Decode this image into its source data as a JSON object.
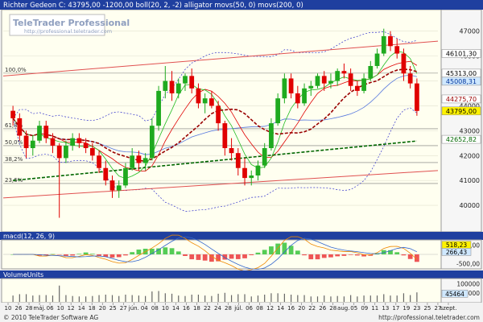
{
  "title": "Richter Gedeon C: 43795,00 -1200,00 boll(20, 2, -2) alligator movs(50, 0) movs(200, 0)",
  "watermark": {
    "brand": "TeleTrader Professional",
    "url": "http://professional.teletrader.com"
  },
  "footer": {
    "copyright": "© 2010 TeleTrader Software AG",
    "url": "http://professional.teletrader.com"
  },
  "colors": {
    "background": "#fffff0",
    "panel_header": "#1f3f9f",
    "candle_up": "#1faa1f",
    "candle_down": "#e00000",
    "boll": "#3333cc",
    "movs50": "#990000",
    "movs200": "#006600",
    "channel": "#e05050",
    "volume": "#666666"
  },
  "chart_data": [
    {
      "type": "candlestick",
      "ylim": [
        39000,
        47800
      ],
      "y_ticks": [
        "47000",
        "46000",
        "45000",
        "44000",
        "43000",
        "42000",
        "41000",
        "40000"
      ],
      "fib_levels": [
        {
          "label": "100,0%",
          "value": 45313
        },
        {
          "label": "61,8%",
          "value": 43080
        },
        {
          "label": "50,0%",
          "value": 42400
        },
        {
          "label": "38,2%",
          "value": 41720
        },
        {
          "label": "23,6%",
          "value": 40880
        }
      ],
      "price_tags": [
        {
          "text": "46101,30",
          "value": 46101,
          "bg": "#ffffff",
          "fg": "#000000"
        },
        {
          "text": "45313,00",
          "value": 45313,
          "bg": "#ffffff",
          "fg": "#000000"
        },
        {
          "text": "45008,31",
          "value": 45008,
          "bg": "#cfe8ff",
          "fg": "#003399"
        },
        {
          "text": "44275,70",
          "value": 44276,
          "bg": "#ffffff",
          "fg": "#990000"
        },
        {
          "text": "43795,00",
          "value": 43795,
          "bg": "#fff200",
          "fg": "#000000"
        },
        {
          "text": "42652,82",
          "value": 42653,
          "bg": "#ffffff",
          "fg": "#006600"
        }
      ],
      "candles_ohlc": [
        [
          43800,
          44000,
          43200,
          43500
        ],
        [
          43500,
          43700,
          42600,
          42800
        ],
        [
          42800,
          43000,
          41900,
          42300
        ],
        [
          42300,
          42800,
          42000,
          42600
        ],
        [
          42600,
          43400,
          42500,
          43200
        ],
        [
          43200,
          43400,
          42500,
          42700
        ],
        [
          42700,
          42900,
          42100,
          42400
        ],
        [
          42400,
          42500,
          39500,
          41900
        ],
        [
          41900,
          42600,
          41700,
          42400
        ],
        [
          42400,
          42900,
          42200,
          42700
        ],
        [
          42700,
          42900,
          42300,
          42500
        ],
        [
          42500,
          42700,
          42100,
          42300
        ],
        [
          42300,
          42500,
          41800,
          42000
        ],
        [
          42000,
          42200,
          41300,
          41500
        ],
        [
          41500,
          41800,
          40800,
          41000
        ],
        [
          41000,
          41200,
          40300,
          40600
        ],
        [
          40600,
          41000,
          40300,
          40800
        ],
        [
          40800,
          41700,
          40700,
          41500
        ],
        [
          41500,
          42300,
          41400,
          42000
        ],
        [
          42000,
          42200,
          41400,
          41700
        ],
        [
          41700,
          42100,
          41400,
          41900
        ],
        [
          41900,
          43500,
          41800,
          43200
        ],
        [
          43200,
          44800,
          43000,
          44600
        ],
        [
          44600,
          45600,
          44300,
          45000
        ],
        [
          45000,
          45400,
          44200,
          44500
        ],
        [
          44500,
          45100,
          44300,
          44900
        ],
        [
          44900,
          45300,
          44600,
          45200
        ],
        [
          45200,
          45500,
          44500,
          44700
        ],
        [
          44700,
          44900,
          43900,
          44100
        ],
        [
          44100,
          44500,
          43700,
          44300
        ],
        [
          44300,
          44600,
          43900,
          44000
        ],
        [
          44000,
          44200,
          43000,
          43300
        ],
        [
          43300,
          43400,
          42000,
          42300
        ],
        [
          42300,
          42700,
          41800,
          42100
        ],
        [
          42100,
          42300,
          41200,
          41500
        ],
        [
          41500,
          41900,
          40800,
          41100
        ],
        [
          41100,
          41400,
          40800,
          41200
        ],
        [
          41200,
          41800,
          41000,
          41600
        ],
        [
          41600,
          42500,
          41500,
          42300
        ],
        [
          42300,
          43500,
          42200,
          43300
        ],
        [
          43300,
          44500,
          43200,
          44300
        ],
        [
          44300,
          45300,
          44100,
          45100
        ],
        [
          45100,
          45300,
          44300,
          44500
        ],
        [
          44500,
          44800,
          43900,
          44100
        ],
        [
          44100,
          44900,
          44000,
          44700
        ],
        [
          44700,
          45000,
          44400,
          44800
        ],
        [
          44800,
          45300,
          44700,
          45200
        ],
        [
          45200,
          45400,
          44600,
          44900
        ],
        [
          44900,
          45300,
          44700,
          45000
        ],
        [
          45000,
          45500,
          44800,
          45400
        ],
        [
          45400,
          45700,
          45100,
          45300
        ],
        [
          45300,
          45500,
          44600,
          44800
        ],
        [
          44800,
          45000,
          44400,
          44600
        ],
        [
          44600,
          45300,
          44500,
          45100
        ],
        [
          45100,
          45800,
          45000,
          45600
        ],
        [
          45600,
          46300,
          45500,
          46100
        ],
        [
          46100,
          47100,
          46000,
          46800
        ],
        [
          46800,
          47000,
          46200,
          46400
        ],
        [
          46400,
          46700,
          45900,
          46100
        ],
        [
          46100,
          46300,
          45000,
          45300
        ],
        [
          45300,
          45600,
          44700,
          44900
        ],
        [
          44900,
          45100,
          43600,
          43795
        ]
      ],
      "x_ticks": [
        "10",
        "26",
        "28",
        "máj.",
        "06",
        "10",
        "12",
        "14",
        "18",
        "20",
        "25",
        "27",
        "jún.",
        "04",
        "08",
        "10",
        "14",
        "16",
        "18",
        "22",
        "24",
        "28",
        "júl.",
        "06",
        "08",
        "12",
        "14",
        "16",
        "20",
        "22",
        "26",
        "28",
        "aug.",
        "05",
        "09",
        "11",
        "13",
        "17",
        "19",
        "23",
        "25",
        "27",
        "szept."
      ]
    },
    {
      "type": "line",
      "title": "macd(12, 26, 9)",
      "ylim": [
        -700,
        700
      ],
      "y_ticks": [
        "500,00",
        "-500,00"
      ],
      "value_tags": [
        {
          "text": "518,23",
          "value": 518,
          "bg": "#fff200"
        },
        {
          "text": "266,43",
          "value": 266,
          "bg": "#cfe8ff"
        }
      ]
    },
    {
      "type": "bar",
      "title": "VolumeUnits",
      "ylim": [
        0,
        120000
      ],
      "y_ticks": [
        "100000",
        "50000"
      ],
      "value_tags": [
        {
          "text": "45464",
          "value": 45464,
          "bg": "#cfe8ff"
        }
      ]
    }
  ]
}
